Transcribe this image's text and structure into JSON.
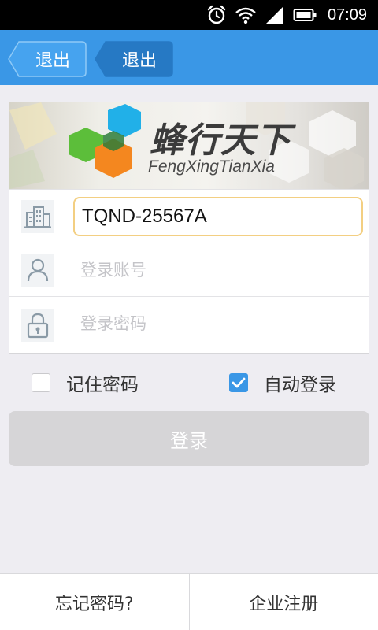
{
  "status_bar": {
    "time": "07:09",
    "icons": [
      "alarm-icon",
      "wifi-icon",
      "signal-icon",
      "battery-icon"
    ]
  },
  "header": {
    "back_buttons": [
      {
        "label": "退出"
      },
      {
        "label": "退出"
      }
    ],
    "background_color": "#3a97e6"
  },
  "banner": {
    "brand_cn": "蜂行天下",
    "brand_en": "FengXingTianXia",
    "logo_colors": [
      "#21b0e8",
      "#5cbe3a",
      "#f4871f"
    ]
  },
  "form": {
    "company_code": {
      "value": "TQND-25567A",
      "icon": "building-icon"
    },
    "account": {
      "placeholder": "登录账号",
      "icon": "user-icon"
    },
    "password": {
      "placeholder": "登录密码",
      "icon": "lock-icon"
    }
  },
  "options": {
    "remember_password": {
      "label": "记住密码",
      "checked": false
    },
    "auto_login": {
      "label": "自动登录",
      "checked": true
    }
  },
  "login_button": {
    "label": "登录"
  },
  "bottom_bar": {
    "forgot_password": "忘记密码?",
    "enterprise_register": "企业注册"
  }
}
